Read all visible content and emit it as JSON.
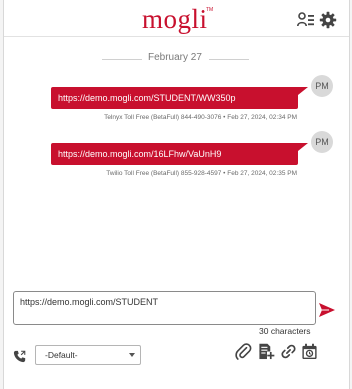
{
  "header": {
    "logo": "mogli",
    "logo_tm": "TM",
    "icons": [
      "user-list-icon",
      "gear-icon"
    ]
  },
  "conversation": {
    "date_label": "February 27",
    "messages": [
      {
        "avatar": "PM",
        "text": "https://demo.mogli.com/STUDENT/WW350p",
        "meta": "Telnyx Toll Free (BetaFull) 844-490-3076 • Feb 27, 2024, 02:34 PM"
      },
      {
        "avatar": "PM",
        "text": "https://demo.mogli.com/16LFhw/VaUnH9",
        "meta": "Twilio Toll Free (BetaFull) 855-928-4597 • Feb 27, 2024, 02:35 PM"
      }
    ]
  },
  "composer": {
    "value": "https://demo.mogli.com/STUDENT",
    "char_count": "30 characters",
    "template_select": "-Default-"
  },
  "colors": {
    "brand": "#c8102e",
    "icon": "#444444"
  }
}
